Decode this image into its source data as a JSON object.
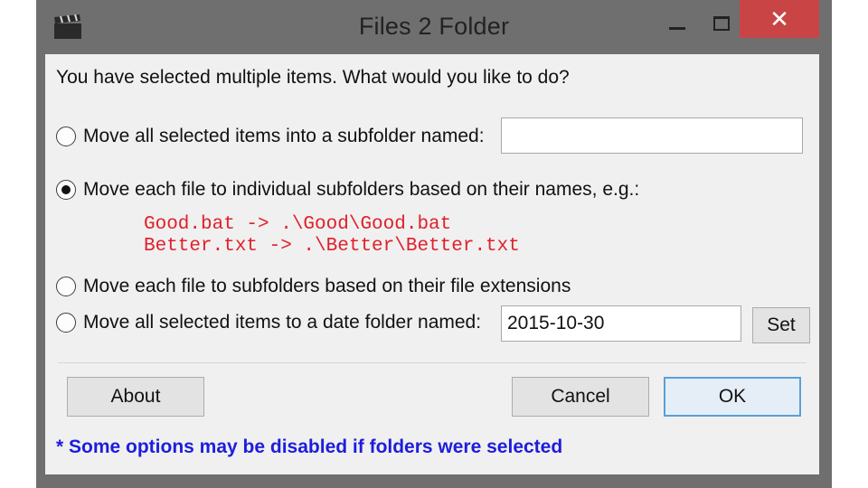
{
  "window": {
    "title": "Files 2 Folder",
    "app_icon": "clapperboard-icon",
    "close_glyph": "✕"
  },
  "prompt": "You have selected multiple items.  What would you like to do?",
  "options": [
    {
      "label": "Move all selected items into a subfolder named:",
      "selected": false,
      "input_value": ""
    },
    {
      "label": "Move each file to individual subfolders based on their names, e.g.:",
      "selected": true,
      "examples": [
        "Good.bat -> .\\Good\\Good.bat",
        "Better.txt -> .\\Better\\Better.txt"
      ]
    },
    {
      "label": "Move each file to subfolders based on their file extensions",
      "selected": false
    },
    {
      "label": "Move all selected items to a date folder named:",
      "selected": false,
      "input_value": "2015-10-30",
      "set_label": "Set"
    }
  ],
  "buttons": {
    "about": "About",
    "cancel": "Cancel",
    "ok": "OK"
  },
  "footnote": "* Some options may be disabled if folders were selected",
  "colors": {
    "example_text": "#e0202a",
    "footnote_text": "#1d1ddc",
    "close_button": "#c94545",
    "frame": "#6f6f6f"
  }
}
